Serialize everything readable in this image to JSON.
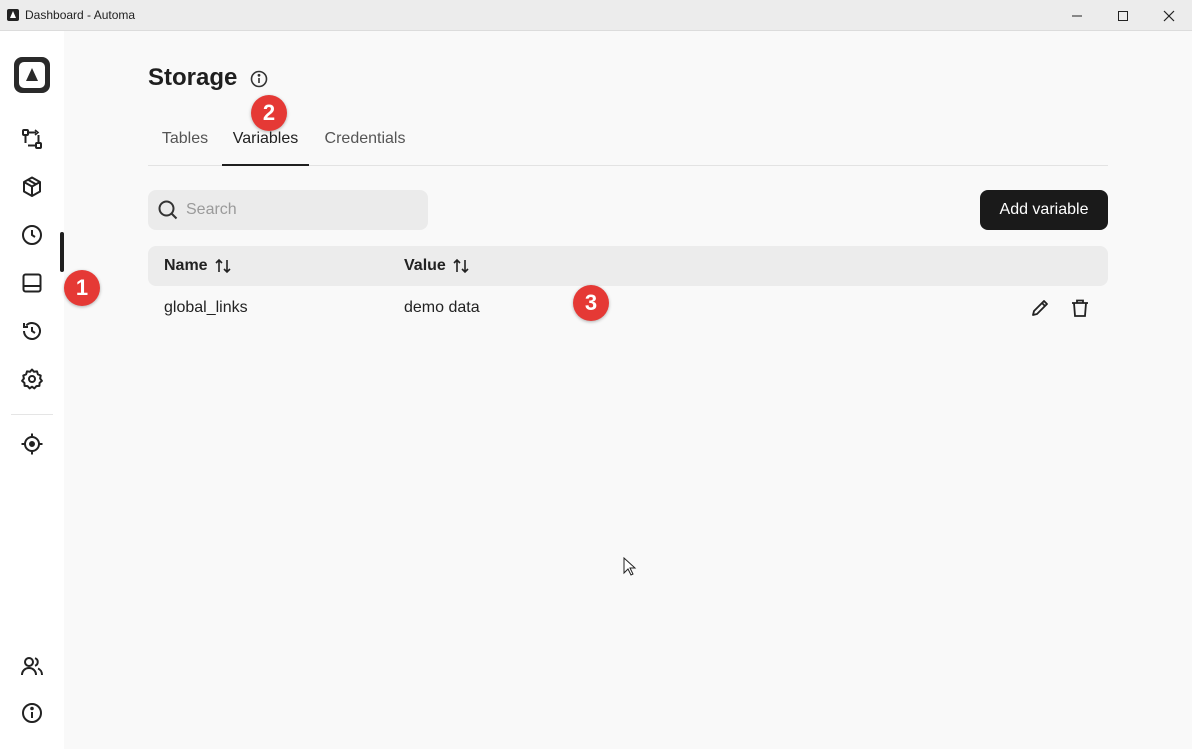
{
  "window": {
    "title": "Dashboard - Automa"
  },
  "sidebar": {
    "items": [
      {
        "icon": "workflow-icon"
      },
      {
        "icon": "package-icon"
      },
      {
        "icon": "clock-icon"
      },
      {
        "icon": "storage-icon",
        "active": true
      },
      {
        "icon": "history-icon"
      },
      {
        "icon": "settings-icon"
      },
      {
        "icon": "crosshair-icon"
      },
      {
        "icon": "users-icon"
      },
      {
        "icon": "info-icon"
      }
    ]
  },
  "page": {
    "title": "Storage"
  },
  "tabs": [
    {
      "label": "Tables"
    },
    {
      "label": "Variables",
      "active": true
    },
    {
      "label": "Credentials"
    }
  ],
  "search": {
    "placeholder": "Search",
    "value": ""
  },
  "toolbar": {
    "add_label": "Add variable"
  },
  "table": {
    "columns": [
      "Name",
      "Value"
    ],
    "rows": [
      {
        "name": "global_links",
        "value": "demo data"
      }
    ]
  },
  "markers": [
    "1",
    "2",
    "3"
  ],
  "colors": {
    "marker": "#e53935",
    "primary_button": "#1a1a1a",
    "header_bg": "#ececec"
  }
}
